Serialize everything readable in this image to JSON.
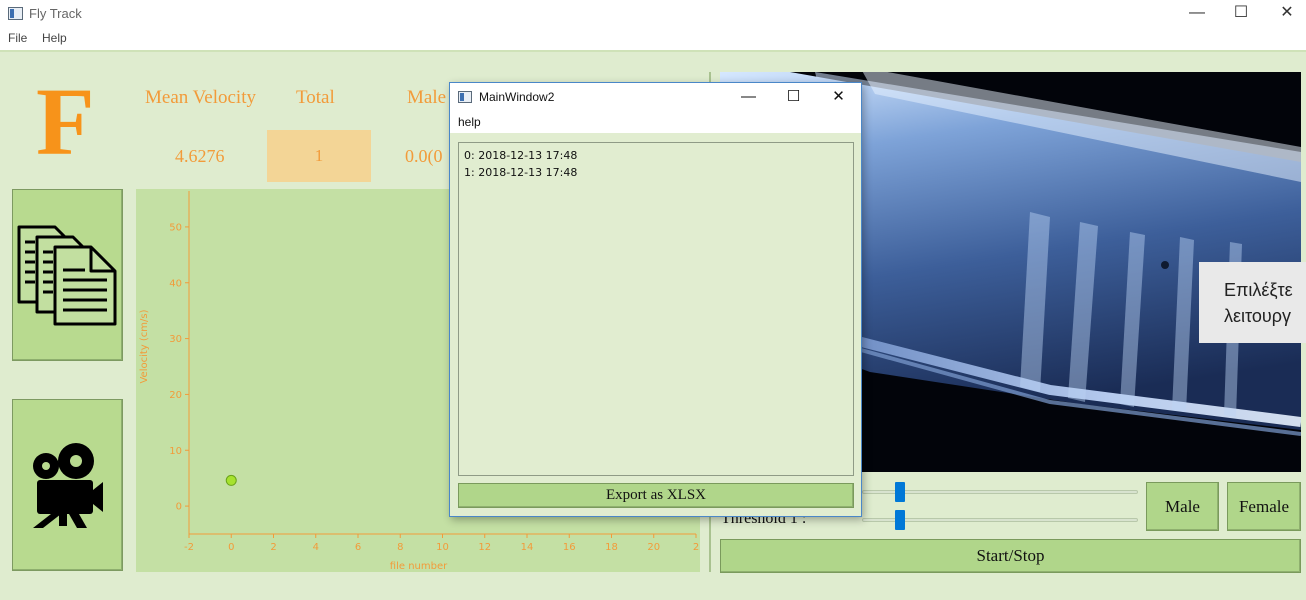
{
  "window": {
    "title": "Fly Track",
    "controls": {
      "minimize": "—",
      "maximize": "☐",
      "close": "✕"
    }
  },
  "menu": {
    "file": "File",
    "help": "Help"
  },
  "header": {
    "logo_letter": "F",
    "mean_velocity_label": "Mean Velocity",
    "mean_velocity_value": "4.6276",
    "total_label": "Total",
    "total_value": "1",
    "male_label": "Male",
    "male_value": "0.0(0"
  },
  "icons": {
    "files": "files-icon",
    "camera": "video-camera-icon"
  },
  "chart_data": {
    "type": "scatter",
    "xlabel": "file number",
    "ylabel": "Velocity  (cm/s)",
    "x_ticks": [
      "-2",
      "0",
      "2",
      "4",
      "6",
      "8",
      "10",
      "12",
      "14",
      "16",
      "18",
      "20",
      "2"
    ],
    "y_ticks": [
      "0",
      "10",
      "20",
      "30",
      "40",
      "50"
    ],
    "xlim": [
      -2,
      22
    ],
    "ylim": [
      -5,
      55
    ],
    "points": [
      {
        "x": 0,
        "y": 4.6
      }
    ],
    "point_color": "#a6e22e"
  },
  "video": {
    "tooltip_line1": "Επιλέξτε",
    "tooltip_line2": "λειτουργ"
  },
  "controls": {
    "threshold_label": "Threshold 1 :",
    "male_button": "Male",
    "female_button": "Female",
    "start_stop_button": "Start/Stop"
  },
  "dialog": {
    "title": "MainWindow2",
    "menu_help": "help",
    "list_items": [
      "0: 2018-12-13 17:48",
      "1: 2018-12-13 17:48"
    ],
    "export_button": "Export as XLSX",
    "controls": {
      "minimize": "—",
      "maximize": "☐",
      "close": "✕"
    }
  },
  "colors": {
    "accent_orange": "#f7931a",
    "button_green": "#b0d68a",
    "slider_blue": "#0078d7"
  }
}
